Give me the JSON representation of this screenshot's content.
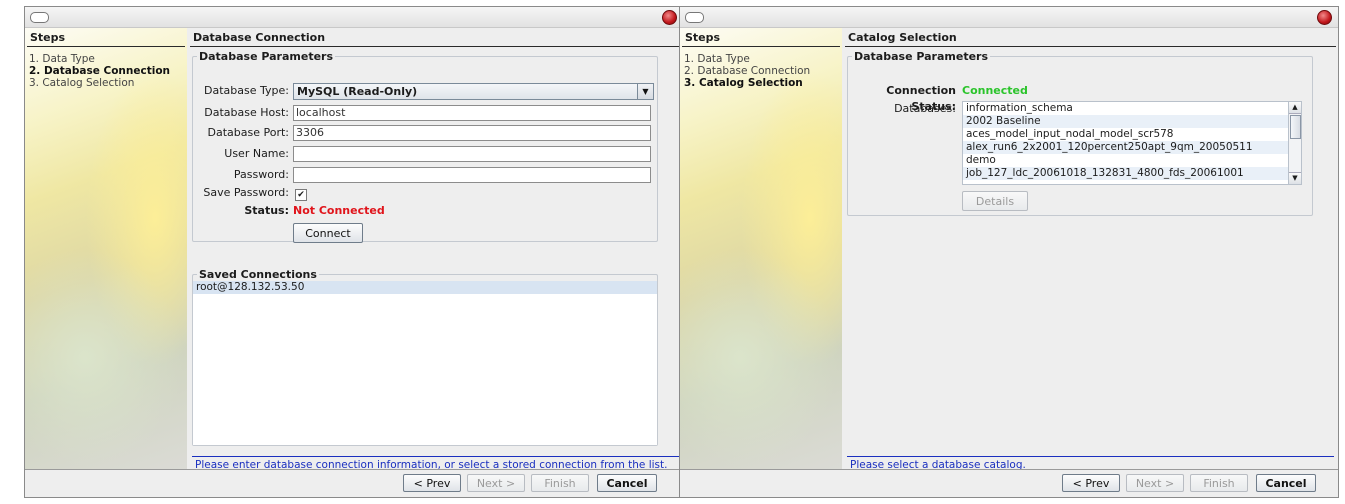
{
  "steps_title": "Steps",
  "steps": [
    "1. Data Type",
    "2. Database Connection",
    "3. Catalog Selection"
  ],
  "nav_buttons": {
    "prev": "< Prev",
    "next": "Next >",
    "finish": "Finish",
    "cancel": "Cancel"
  },
  "left_window": {
    "section_title": "Database Connection",
    "params_legend": "Database Parameters",
    "labels": {
      "type": "Database Type:",
      "host": "Database Host:",
      "port": "Database Port:",
      "user": "User Name:",
      "password": "Password:",
      "save_password": "Save Password:",
      "status": "Status:"
    },
    "values": {
      "type": "MySQL (Read-Only)",
      "host": "localhost",
      "port": "3306",
      "user": "",
      "password": "",
      "save_password_checked": true,
      "status": "Not Connected"
    },
    "connect_button": "Connect",
    "saved_legend": "Saved Connections",
    "saved_connections": [
      "root@128.132.53.50"
    ],
    "hint": "Please enter database connection information, or select a stored connection from the list."
  },
  "right_window": {
    "section_title": "Catalog Selection",
    "params_legend": "Database Parameters",
    "connection_status_label": "Connection Status:",
    "connection_status": "Connected",
    "databases_label": "Databases:",
    "databases": [
      "information_schema",
      "2002 Baseline",
      "aces_model_input_nodal_model_scr578",
      "alex_run6_2x2001_120percent250apt_9qm_20050511",
      "demo",
      "job_127_ldc_20061018_132831_4800_fds_20061001"
    ],
    "details_button": "Details",
    "hint": "Please select a database catalog."
  },
  "colors": {
    "connected": "#2bc42b",
    "not_connected": "#e0141b",
    "hint": "#1a2fbf"
  }
}
